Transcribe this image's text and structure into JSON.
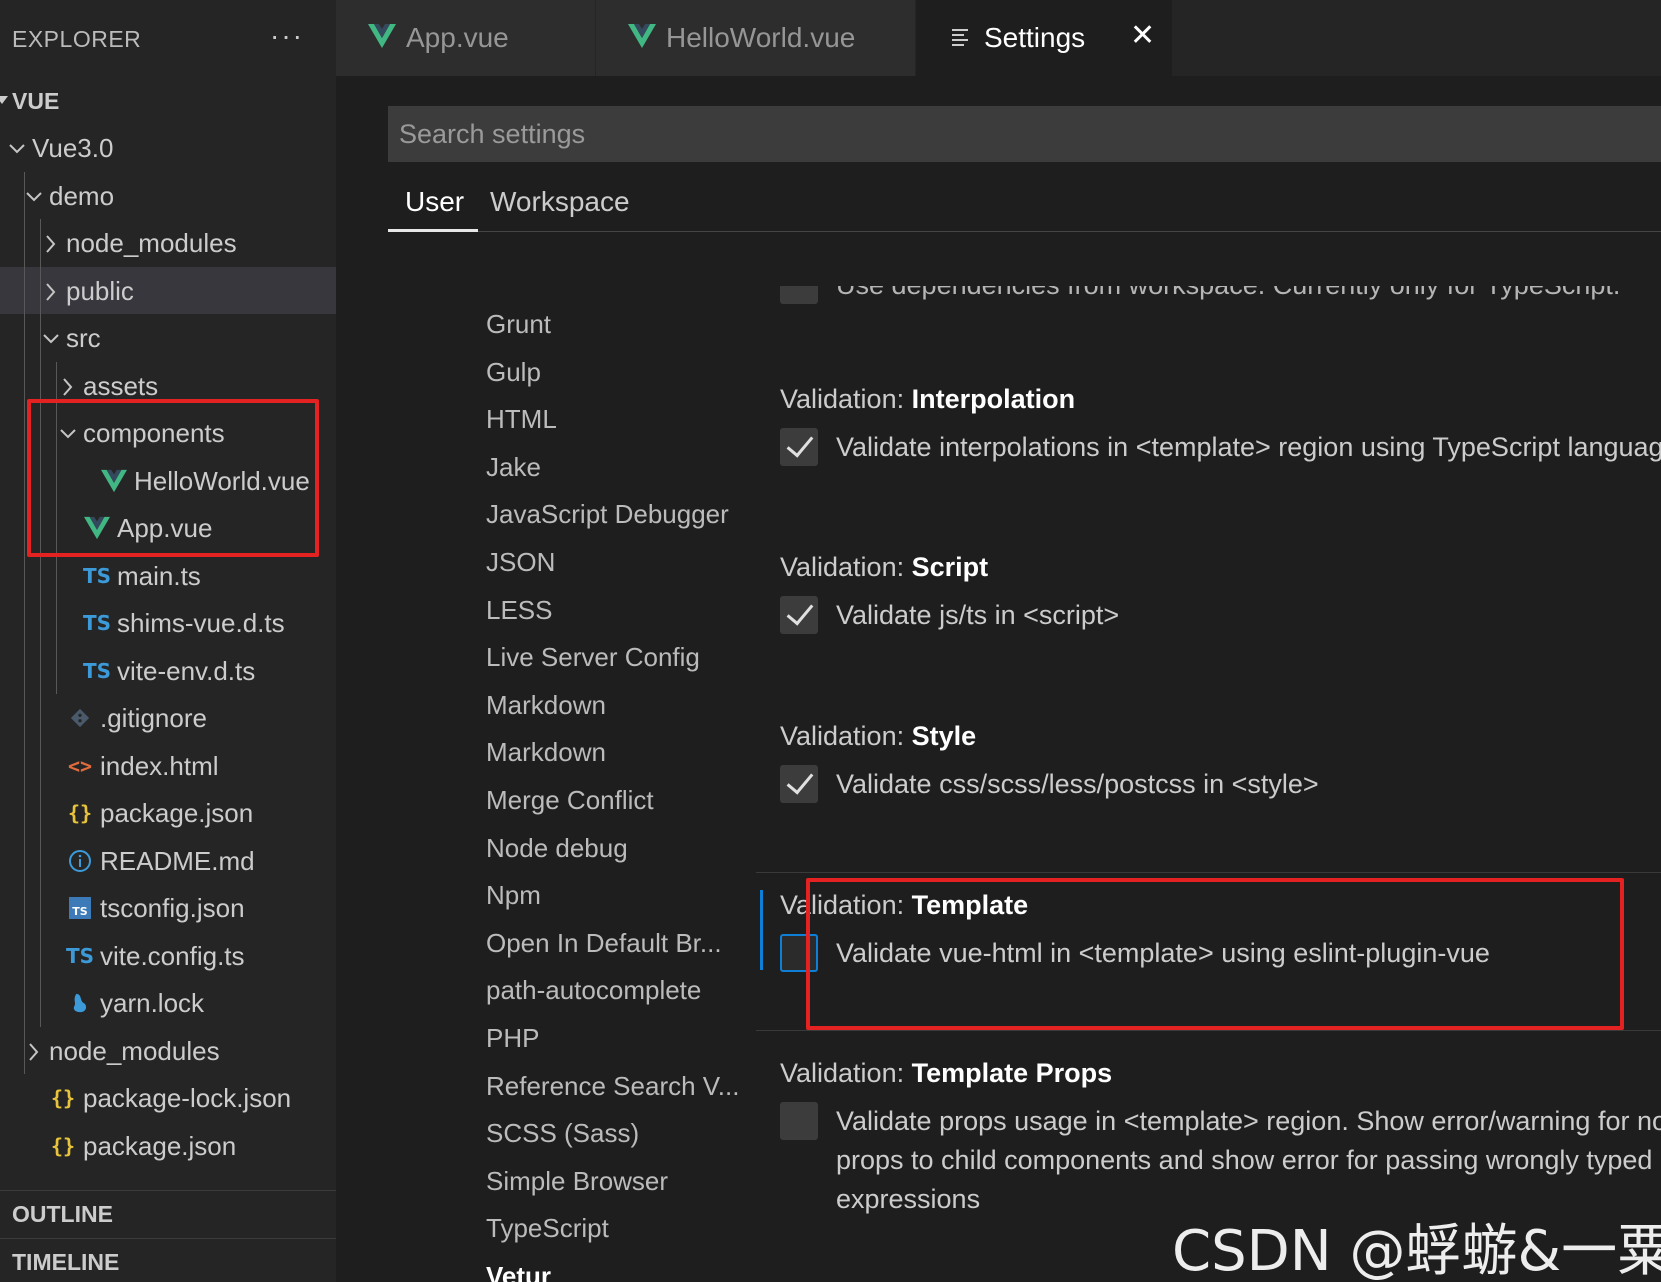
{
  "explorer": {
    "title": "EXPLORER",
    "more_label": "···",
    "section_vue": "VUE",
    "section_outline": "OUTLINE",
    "section_timeline": "TIMELINE",
    "tree": [
      {
        "label": "Vue3.0",
        "kind": "folder-open"
      },
      {
        "label": "demo",
        "kind": "folder-open"
      },
      {
        "label": "node_modules",
        "kind": "folder-closed"
      },
      {
        "label": "public",
        "kind": "folder-closed",
        "selected": true
      },
      {
        "label": "src",
        "kind": "folder-open"
      },
      {
        "label": "assets",
        "kind": "folder-closed"
      },
      {
        "label": "components",
        "kind": "folder-open"
      },
      {
        "label": "HelloWorld.vue",
        "kind": "vue-file"
      },
      {
        "label": "App.vue",
        "kind": "vue-file"
      },
      {
        "label": "main.ts",
        "kind": "ts-file"
      },
      {
        "label": "shims-vue.d.ts",
        "kind": "ts-file"
      },
      {
        "label": "vite-env.d.ts",
        "kind": "ts-file"
      },
      {
        "label": ".gitignore",
        "kind": "git-file"
      },
      {
        "label": "index.html",
        "kind": "html-file"
      },
      {
        "label": "package.json",
        "kind": "json-file"
      },
      {
        "label": "README.md",
        "kind": "info-file"
      },
      {
        "label": "tsconfig.json",
        "kind": "tsconfig-file"
      },
      {
        "label": "vite.config.ts",
        "kind": "ts-file"
      },
      {
        "label": "yarn.lock",
        "kind": "yarn-file"
      },
      {
        "label": "node_modules",
        "kind": "folder-closed"
      },
      {
        "label": "package-lock.json",
        "kind": "json-file"
      },
      {
        "label": "package.json",
        "kind": "json-file"
      }
    ],
    "icons": {
      "ts": "TS",
      "json": "{}",
      "html": "<>"
    }
  },
  "tabs": [
    {
      "label": "App.vue",
      "icon": "vue-icon"
    },
    {
      "label": "HelloWorld.vue",
      "icon": "vue-icon"
    },
    {
      "label": "Settings",
      "icon": "settings-list-icon",
      "active": true,
      "close": "✕"
    }
  ],
  "settings": {
    "search_placeholder": "Search settings",
    "scopes": [
      "User",
      "Workspace"
    ],
    "toc": [
      "Grunt",
      "Gulp",
      "HTML",
      "Jake",
      "JavaScript Debugger",
      "JSON",
      "LESS",
      "Live Server Config",
      "Markdown",
      "Markdown",
      "Merge Conflict",
      "Node debug",
      "Npm",
      "Open In Default Br...",
      "path-autocomplete",
      "PHP",
      "Reference Search V...",
      "SCSS (Sass)",
      "Simple Browser",
      "TypeScript",
      "Vetur"
    ],
    "partial_top": "Use dependencies from workspace. Currently only for TypeScript.",
    "items": [
      {
        "category": "Validation: ",
        "name": "Interpolation",
        "checked": true,
        "description": "Validate interpolations in <template> region using TypeScript language service"
      },
      {
        "category": "Validation: ",
        "name": "Script",
        "checked": true,
        "description": "Validate js/ts in <script>"
      },
      {
        "category": "Validation: ",
        "name": "Style",
        "checked": true,
        "description": "Validate css/scss/less/postcss in <style>"
      },
      {
        "category": "Validation: ",
        "name": "Template",
        "checked": false,
        "description": "Validate vue-html in <template> using eslint-plugin-vue"
      },
      {
        "category": "Validation: ",
        "name": "Template Props",
        "checked": false,
        "description_lines": [
          "Validate props usage in <template> region. Show error/warning for not passing declared props to child components and show error for passing wrongly typed interpolation",
          "props to child components and show error for passing wrongly typed interpolation",
          "expressions"
        ]
      }
    ]
  },
  "watermark": "CSDN @蜉蝣&一粟",
  "colors": {
    "vue_green": "#41b883",
    "vue_dark": "#35495e",
    "accent": "#0e7fd4",
    "highlight": "#e52222"
  }
}
